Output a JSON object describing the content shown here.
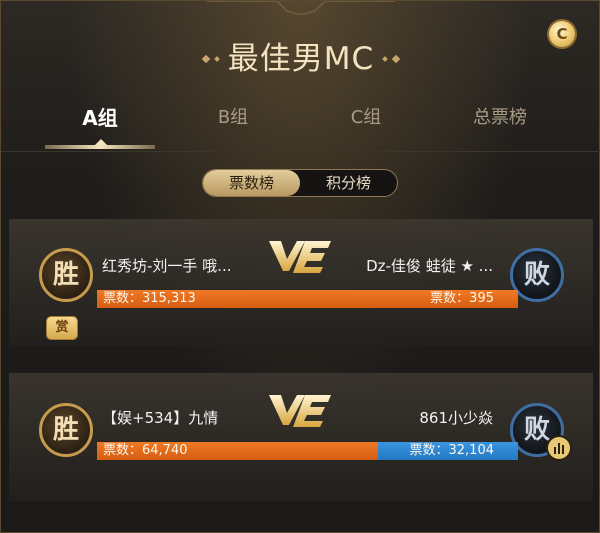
{
  "title": "最佳男MC",
  "coin_label": "C",
  "tabs": [
    {
      "label": "A组"
    },
    {
      "label": "B组"
    },
    {
      "label": "C组"
    },
    {
      "label": "总票榜"
    }
  ],
  "toggle": {
    "votes_label": "票数榜",
    "points_label": "积分榜",
    "selected": "票数榜"
  },
  "matches": [
    {
      "left": {
        "result": "胜",
        "name": "红秀坊-刘一手 哦...",
        "votes_text": "票数：315,313",
        "votes": 315313
      },
      "right": {
        "result": "败",
        "name": "Dz-佳俊 蛙徒 ★ ...",
        "votes_text": "票数：395",
        "votes": 395
      },
      "vs_label": "VS",
      "reward_label": "赏",
      "left_share": 0.999
    },
    {
      "left": {
        "result": "胜",
        "name": "【娱+534】九情",
        "votes_text": "票数：64,740",
        "votes": 64740
      },
      "right": {
        "result": "败",
        "name": "861小少焱",
        "votes_text": "票数：32,104",
        "votes": 32104
      },
      "vs_label": "VS",
      "left_share": 0.668
    }
  ],
  "colors": {
    "gold": "#c7a66d",
    "win_bar": "#e8681a",
    "lose_bar_blue": "#2f88d6",
    "title": "#f4e3c1"
  },
  "icons": [
    "coin-icon",
    "vs-icon",
    "reward-icon",
    "play-icon"
  ]
}
